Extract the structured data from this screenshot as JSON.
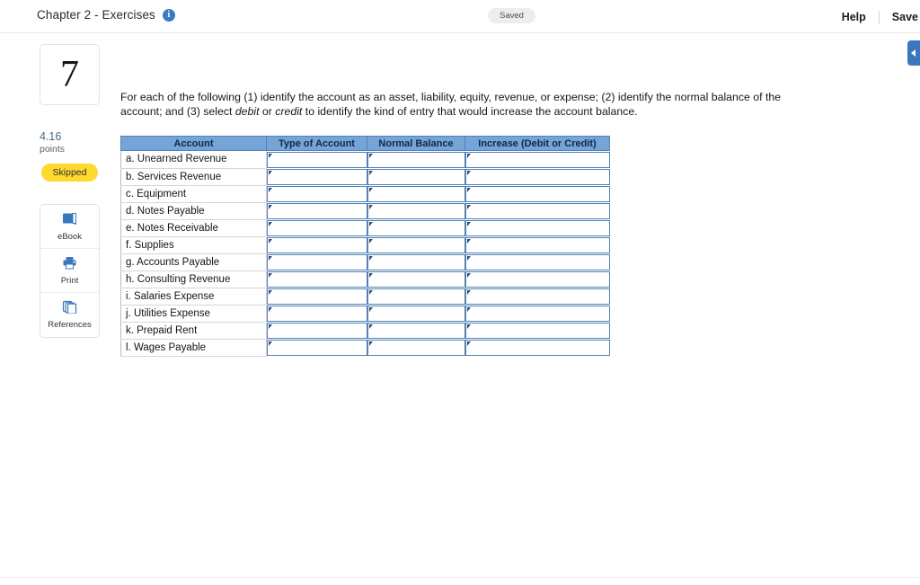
{
  "header": {
    "title": "Chapter 2 - Exercises",
    "info_icon": "info-icon",
    "saved_status": "Saved",
    "help_label": "Help",
    "save_label": "Save"
  },
  "edge_tab": {
    "icon": "chevron-right-icon"
  },
  "sidebar": {
    "question_number": "7",
    "points_value": "4.16",
    "points_label": "points",
    "status_badge": "Skipped",
    "tools": [
      {
        "label": "eBook",
        "icon": "book-icon"
      },
      {
        "label": "Print",
        "icon": "printer-icon"
      },
      {
        "label": "References",
        "icon": "references-icon"
      }
    ]
  },
  "main": {
    "instructions_part1": "For each of the following (1) identify the account as an asset, liability, equity, revenue, or expense; (2) identify the normal balance of the account; and (3) select ",
    "instructions_debit": "debit",
    "instructions_or": " or ",
    "instructions_credit": "credit",
    "instructions_part2": " to identify the kind of entry that would increase the account balance."
  },
  "table": {
    "columns": [
      "Account",
      "Type of Account",
      "Normal Balance",
      "Increase (Debit or Credit)"
    ],
    "rows": [
      {
        "account": "a. Unearned Revenue",
        "type_of_account": "",
        "normal_balance": "",
        "increase": ""
      },
      {
        "account": "b. Services Revenue",
        "type_of_account": "",
        "normal_balance": "",
        "increase": ""
      },
      {
        "account": "c. Equipment",
        "type_of_account": "",
        "normal_balance": "",
        "increase": ""
      },
      {
        "account": "d. Notes Payable",
        "type_of_account": "",
        "normal_balance": "",
        "increase": ""
      },
      {
        "account": "e. Notes Receivable",
        "type_of_account": "",
        "normal_balance": "",
        "increase": ""
      },
      {
        "account": "f. Supplies",
        "type_of_account": "",
        "normal_balance": "",
        "increase": ""
      },
      {
        "account": "g. Accounts Payable",
        "type_of_account": "",
        "normal_balance": "",
        "increase": ""
      },
      {
        "account": "h. Consulting Revenue",
        "type_of_account": "",
        "normal_balance": "",
        "increase": ""
      },
      {
        "account": "i.  Salaries Expense",
        "type_of_account": "",
        "normal_balance": "",
        "increase": ""
      },
      {
        "account": "j. Utilities Expense",
        "type_of_account": "",
        "normal_balance": "",
        "increase": ""
      },
      {
        "account": "k. Prepaid Rent",
        "type_of_account": "",
        "normal_balance": "",
        "increase": ""
      },
      {
        "account": "l. Wages Payable",
        "type_of_account": "",
        "normal_balance": "",
        "increase": ""
      }
    ]
  },
  "colors": {
    "table_header_bg": "#74a4d8",
    "table_header_text": "#15273f",
    "cell_border_blue": "#5182b5",
    "badge_yellow": "#ffd92e",
    "accent_blue": "#3a78bd",
    "points_blue": "#4a6785",
    "saved_pill_bg": "#eceded"
  }
}
